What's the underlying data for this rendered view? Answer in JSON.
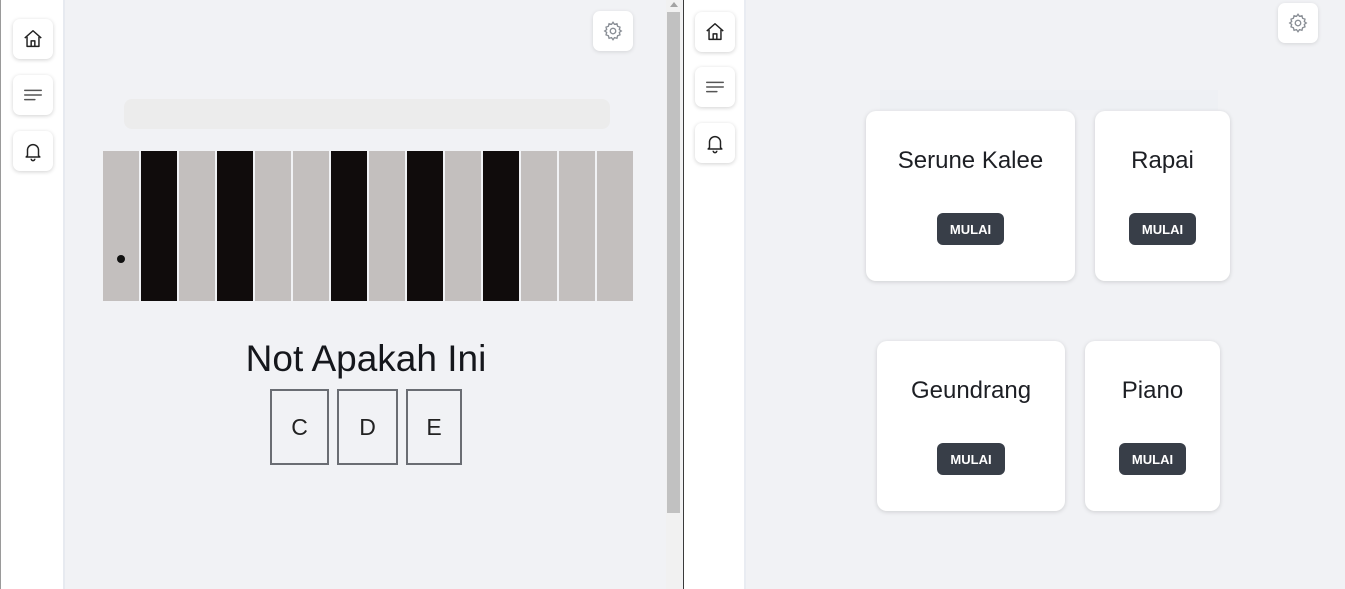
{
  "left_pane": {
    "question": "Not Apakah Ini",
    "keys": [
      "white",
      "black",
      "white",
      "black",
      "white",
      "white",
      "black",
      "white",
      "black",
      "white",
      "black",
      "white",
      "white",
      "white"
    ],
    "answers": [
      "C",
      "D",
      "E"
    ]
  },
  "right_pane": {
    "cards": [
      {
        "title": "Serune Kalee",
        "button": "MULAI"
      },
      {
        "title": "Rapai",
        "button": "MULAI"
      },
      {
        "title": "Geundrang",
        "button": "MULAI"
      },
      {
        "title": "Piano",
        "button": "MULAI"
      }
    ]
  },
  "icons": {
    "nav": [
      "home-icon",
      "menu-icon",
      "bell-icon"
    ],
    "settings": "gear-icon"
  },
  "colors": {
    "background": "#f1f2f5",
    "white_key": "#c3bfbe",
    "black_key": "#100c0c",
    "button": "#383e48"
  }
}
